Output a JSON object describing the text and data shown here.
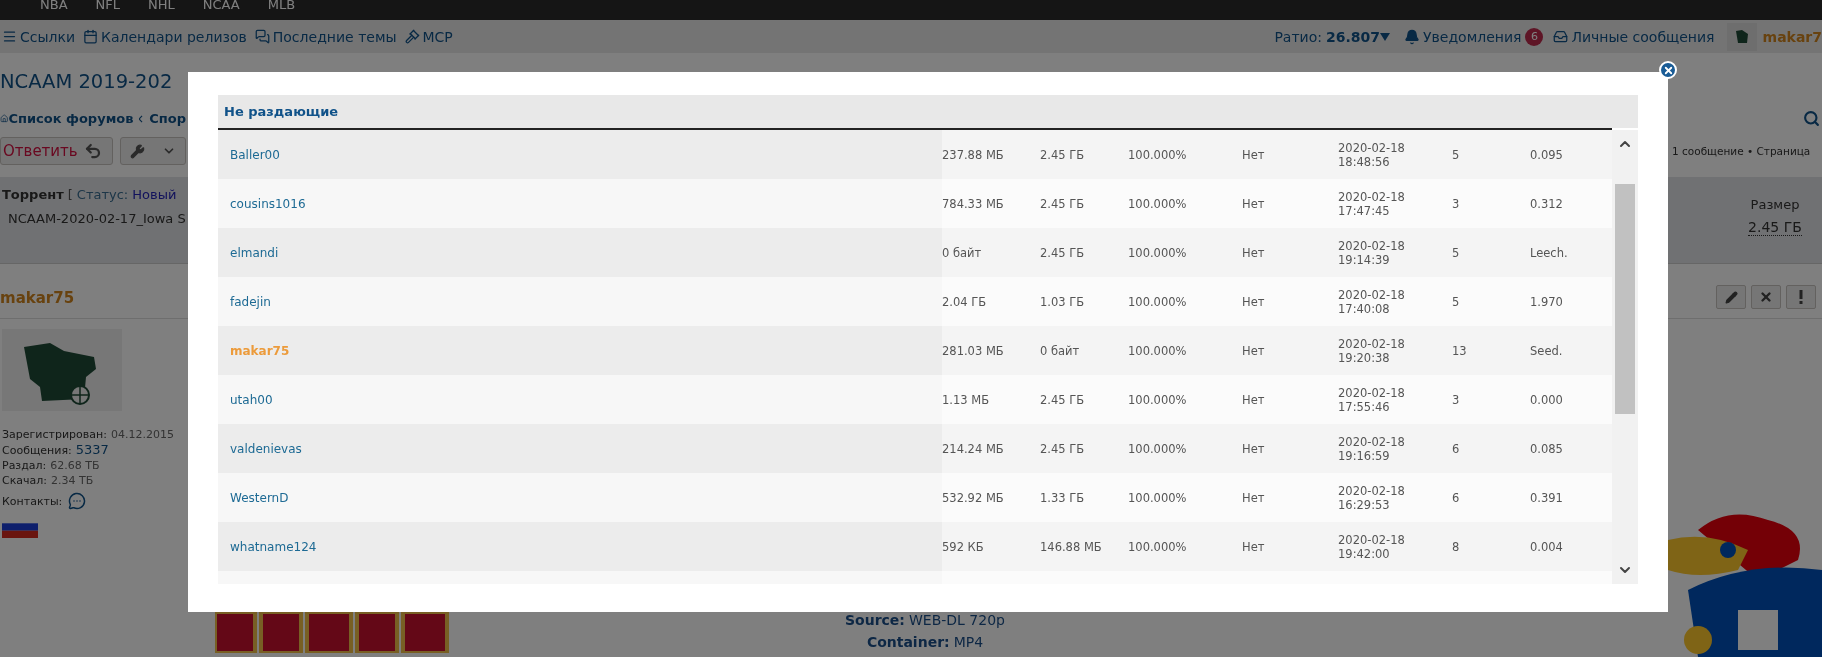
{
  "top_menu": [
    "NBA",
    "NFL",
    "NHL",
    "NCAA",
    "MLB"
  ],
  "navbar": {
    "links": [
      "Ссылки",
      "Календари релизов",
      "Последние темы",
      "MCP"
    ],
    "ratio_label": "Ратио:",
    "ratio": "26.807",
    "notifications": "Уведомления",
    "notifications_count": "6",
    "messages": "Личные сообщения",
    "user": "makar7"
  },
  "page": {
    "title": "NCAAM 2019-202",
    "breadcrumb": [
      "Список форумов",
      "Спор"
    ],
    "reply_button": "Ответить",
    "pagination": "1 сообщение • Страница",
    "torrent": {
      "label": "Торрент",
      "bracket": "[",
      "status_label": "Статус:",
      "status": "Новый",
      "file": "NCAAM-2020-02-17_Iowa S",
      "size_header": "Размер",
      "size": "2.45 ГБ"
    },
    "post": {
      "author": "makar75",
      "stats": [
        {
          "label": "Зарегистрирован:",
          "value": "04.12.2015"
        },
        {
          "label": "Сообщения:",
          "value": "5337"
        },
        {
          "label": "Раздал:",
          "value": "62.68 ТБ"
        },
        {
          "label": "Скачал:",
          "value": "2.34 ТБ"
        }
      ],
      "contacts_label": "Контакты:",
      "body": [
        {
          "label": "Source:",
          "value": "WEB-DL 720p"
        },
        {
          "label": "Container:",
          "value": "MP4"
        }
      ]
    }
  },
  "modal": {
    "title": "Не раздающие",
    "rows": [
      {
        "name": "Baller00",
        "highlighted": false,
        "cells": [
          "237.88 МБ",
          "2.45 ГБ",
          "100.000%",
          "Нет",
          "2020-02-18\n18:48:56",
          "5",
          "0.095"
        ]
      },
      {
        "name": "cousins1016",
        "highlighted": false,
        "cells": [
          "784.33 МБ",
          "2.45 ГБ",
          "100.000%",
          "Нет",
          "2020-02-18\n17:47:45",
          "3",
          "0.312"
        ]
      },
      {
        "name": "elmandi",
        "highlighted": false,
        "cells": [
          "0 байт",
          "2.45 ГБ",
          "100.000%",
          "Нет",
          "2020-02-18\n19:14:39",
          "5",
          "Leech."
        ]
      },
      {
        "name": "fadejin",
        "highlighted": false,
        "cells": [
          "2.04 ГБ",
          "1.03 ГБ",
          "100.000%",
          "Нет",
          "2020-02-18\n17:40:08",
          "5",
          "1.970"
        ]
      },
      {
        "name": "makar75",
        "highlighted": true,
        "cells": [
          "281.03 МБ",
          "0 байт",
          "100.000%",
          "Нет",
          "2020-02-18\n19:20:38",
          "13",
          "Seed."
        ]
      },
      {
        "name": "utah00",
        "highlighted": false,
        "cells": [
          "1.13 МБ",
          "2.45 ГБ",
          "100.000%",
          "Нет",
          "2020-02-18\n17:55:46",
          "3",
          "0.000"
        ]
      },
      {
        "name": "valdenievas",
        "highlighted": false,
        "cells": [
          "214.24 МБ",
          "2.45 ГБ",
          "100.000%",
          "Нет",
          "2020-02-18\n19:16:59",
          "6",
          "0.085"
        ]
      },
      {
        "name": "WesternD",
        "highlighted": false,
        "cells": [
          "532.92 МБ",
          "1.33 ГБ",
          "100.000%",
          "Нет",
          "2020-02-18\n16:29:53",
          "6",
          "0.391"
        ]
      },
      {
        "name": "whatname124",
        "highlighted": false,
        "cells": [
          "592 КБ",
          "146.88 МБ",
          "100.000%",
          "Нет",
          "2020-02-18\n19:42:00",
          "8",
          "0.004"
        ]
      }
    ]
  }
}
